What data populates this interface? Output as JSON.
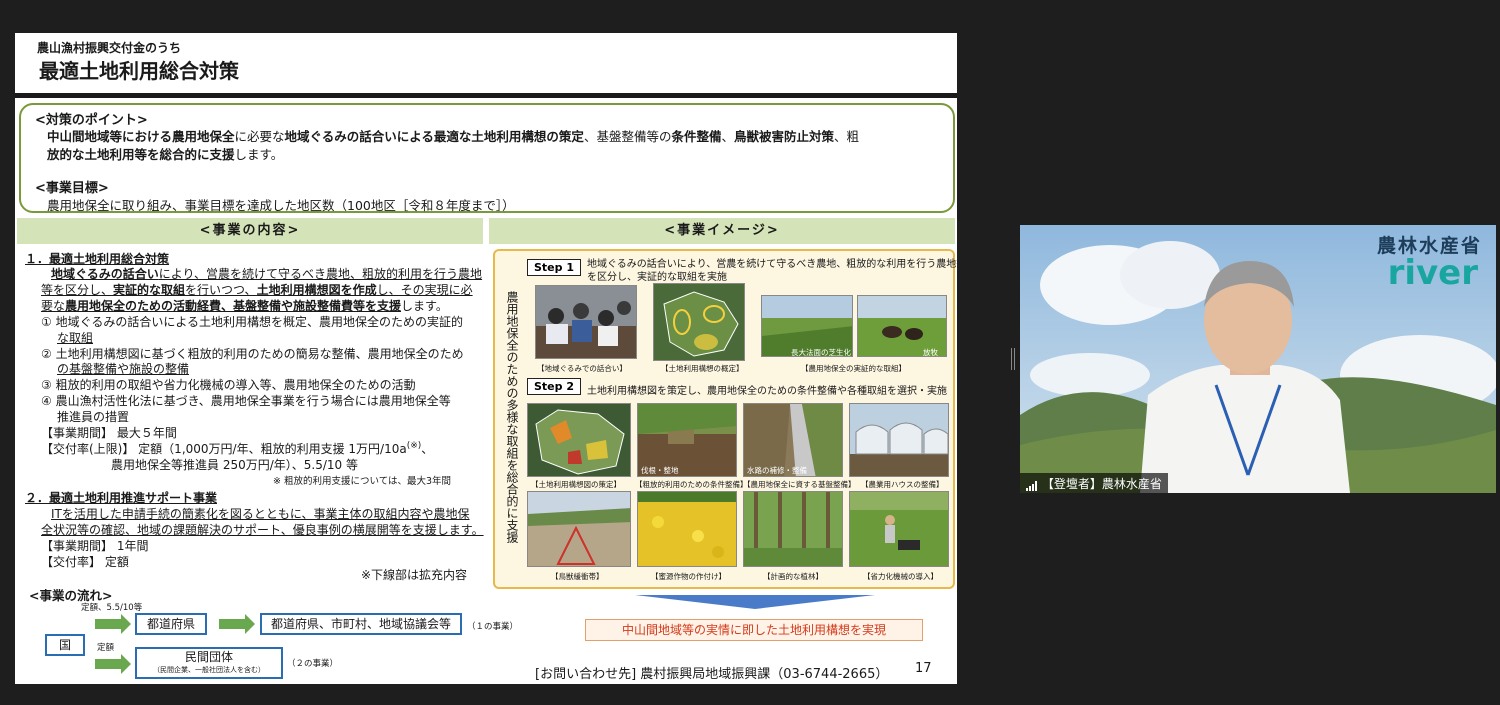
{
  "slide": {
    "subtitle": "農山漁村振興交付金のうち",
    "title": "最適土地利用総合対策",
    "point_heading": "<対策のポイント>",
    "point_line1_a": "中山間地域等における",
    "point_line1_b": "農用地保全",
    "point_line1_c": "に必要な",
    "point_line1_d": "地域ぐるみの話合いによる最適な土地利用構想の策定",
    "point_line1_e": "、基盤整備等の",
    "point_line1_f": "条件整備",
    "point_line1_g": "、",
    "point_line1_h": "鳥獣被害防止対策",
    "point_line1_i": "、粗",
    "point_line2_a": "放的な土地利用等を総合的に支援",
    "point_line2_b": "します。",
    "goal_heading": "<事業目標>",
    "goal_text": "農用地保全に取り組み、事業目標を達成した地区数（100地区［令和８年度まで］）",
    "content_bar": "<事業の内容>",
    "image_bar": "<事業イメージ>",
    "c1_heading": "１．最適土地利用総合対策",
    "c1_l1_a": "地域ぐるみの話合い",
    "c1_l1_b": "により、営農を続けて守るべき農地、粗放的利用を行う農地",
    "c1_l2_a": "等を区分し、",
    "c1_l2_b": "実証的な取組",
    "c1_l2_c": "を行いつつ、",
    "c1_l2_d": "土地利用構想図を作成",
    "c1_l2_e": "し、その実現に必",
    "c1_l3_a": "要な",
    "c1_l3_b": "農用地保全のための活動経費、基盤整備や施設整備費等を支援",
    "c1_l3_c": "します。",
    "c1_i1a": "① 地域ぐるみの話合いによる土地利用構想を概定、農用地保全のための実証的",
    "c1_i1b": "な取組",
    "c1_i2a": "② 土地利用構想図に基づく粗放的利用のための簡易な整備、農用地保全のため",
    "c1_i2b": "の基盤整備や施設の整備",
    "c1_i3": "③ 粗放的利用の取組や省力化機械の導入等、農用地保全のための活動",
    "c1_i4a": "④ 農山漁村活性化法に基づき、農用地保全事業を行う場合には農用地保全等",
    "c1_i4b": "推進員の措置",
    "c1_period": "【事業期間】 最大５年間",
    "c1_rate1": "【交付率(上限)】 定額（1,000万円/年、粗放的利用支援 1万円/10a",
    "c1_rate_mark": "(※)",
    "c1_rate1_end": "、",
    "c1_rate2": "農用地保全等推進員 250万円/年）、5.5/10 等",
    "c1_note": "※ 粗放的利用支援については、最大3年間",
    "c2_heading": "２．最適土地利用推進サポート事業",
    "c2_l1": "ITを活用した申請手続の簡素化を図るとともに、事業主体の取組内容や農地保",
    "c2_l2": "全状況等の確認、地域の課題解決のサポート、優良事例の横展開等を支援します。",
    "c2_period": "【事業期間】 1年間",
    "c2_rate": "【交付率】 定額",
    "expansion_note": "※下線部は拡充内容",
    "flow_heading": "<事業の流れ>",
    "flow_rate_top": "定額、5.5/10等",
    "flow_rate_bottom": "定額",
    "flow_kuni": "国",
    "flow_prefecture": "都道府県",
    "flow_municipal": "都道府県、市町村、地域協議会等",
    "flow_project1": "（１の事業）",
    "flow_private": "民間団体",
    "flow_private_sub": "（民間企業、一般社団法人を含む）",
    "flow_project2": "（２の事業）",
    "vertical_text": "農用地保全のための多様な取組を総合的に支援",
    "step1_label": "Step 1",
    "step1_text_a": "地域ぐるみの話合いにより、営農を続けて守るべき農地、粗放的な利用を行う農地等",
    "step1_text_b": "を区分し、実証的な取組を実施",
    "step2_label": "Step 2",
    "step2_text": "土地利用構想図を策定し、農用地保全のための条件整備や各種取組を選択・実施",
    "cap_r1_1": "【地域ぐるみでの話合い】",
    "cap_r1_2": "【土地利用構想の概定】",
    "cap_r1_3": "【農用地保全の実証的な取組】",
    "lbl_r1_3a": "長大法面の芝生化",
    "lbl_r1_3b": "放牧",
    "cap_r2_1": "【土地利用構想図の策定】",
    "cap_r2_2": "【粗放的利用のための条件整備】",
    "cap_r2_3": "【農用地保全に資する基盤整備】",
    "cap_r2_4": "【農業用ハウスの整備】",
    "lbl_r2_2": "伐根・整地",
    "lbl_r2_3": "水路の補修・整備",
    "cap_r3_1": "【鳥獣緩衝帯】",
    "cap_r3_2": "【蜜源作物の作付け】",
    "cap_r3_3": "【計画的な植林】",
    "cap_r3_4": "【省力化機械の導入】",
    "realize_text": "中山間地域等の実情に即した土地利用構想を実現",
    "contact": "[お問い合わせ先] 農村振興局地域振興課（03-6744-2665）",
    "page_number": "17"
  },
  "video": {
    "logo_text": "農林水産省",
    "brand_text": "river",
    "participant_name": "【登壇者】農林水産省"
  },
  "colors": {
    "accent_green": "#7a9a3a",
    "bar_green": "#d4e3b8",
    "flow_blue": "#2a6db0",
    "realize_red": "#d43a1a",
    "brand_teal": "#1aa6a0"
  }
}
